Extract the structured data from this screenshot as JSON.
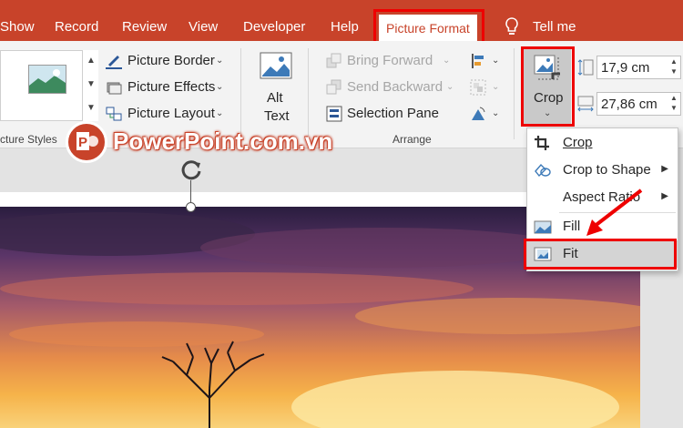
{
  "tabs": {
    "show": "Show",
    "record": "Record",
    "review": "Review",
    "view": "View",
    "developer": "Developer",
    "help": "Help",
    "picture_format": "Picture Format",
    "tell_me": "Tell me"
  },
  "picture_styles": {
    "border": "Picture Border",
    "effects": "Picture Effects",
    "layout": "Picture Layout",
    "group_label": "cture Styles"
  },
  "accessibility": {
    "alt_text_line1": "Alt",
    "alt_text_line2": "Text"
  },
  "arrange": {
    "bring_forward": "Bring Forward",
    "send_backward": "Send Backward",
    "selection_pane": "Selection Pane",
    "group_label": "Arrange"
  },
  "size": {
    "crop_label": "Crop",
    "height": "17,9 cm",
    "width": "27,86 cm"
  },
  "watermark": {
    "text": "PowerPoint.com.vn"
  },
  "crop_menu": {
    "crop": "Crop",
    "crop_to_shape": "Crop to Shape",
    "aspect_ratio": "Aspect Ratio",
    "fill": "Fill",
    "fit": "Fit"
  },
  "colors": {
    "accent": "#c8432a",
    "highlight": "#ee0000"
  }
}
